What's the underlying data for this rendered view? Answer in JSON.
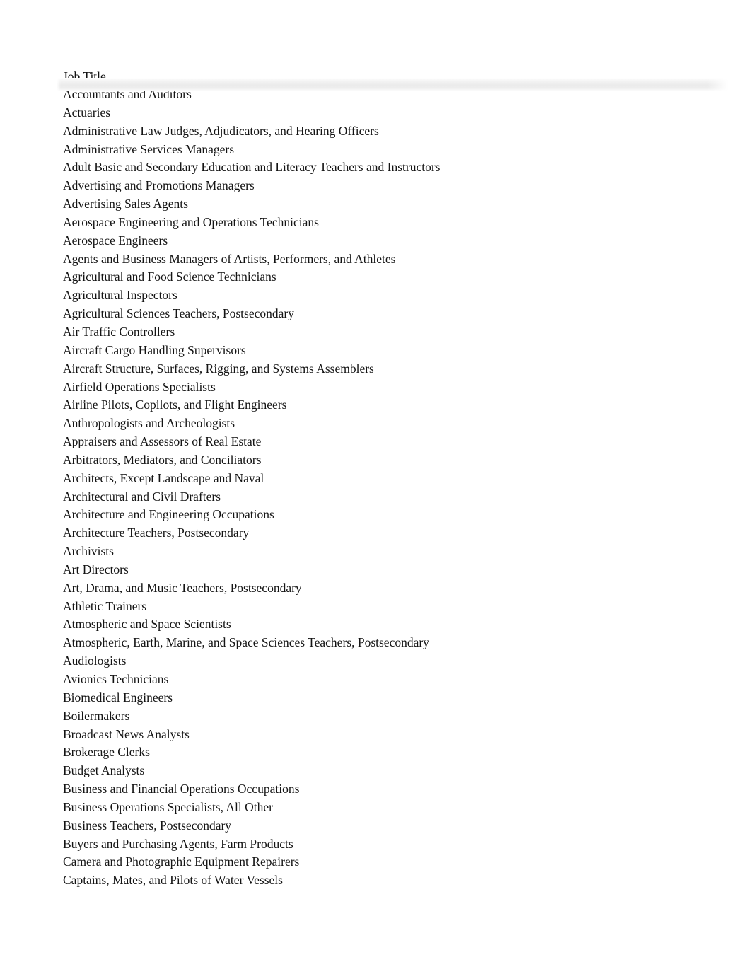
{
  "document": {
    "column_header": "Job Title",
    "text_color": "#141414",
    "background_color": "#ffffff",
    "freeze_shadow_color": "#ebebeb"
  },
  "table": {
    "columns": [
      "Job Title"
    ],
    "rows": [
      "Accountants and Auditors",
      "Actuaries",
      "Administrative Law Judges, Adjudicators, and Hearing Officers",
      "Administrative Services Managers",
      "Adult Basic and Secondary Education and Literacy Teachers and Instructors",
      "Advertising and Promotions Managers",
      "Advertising Sales Agents",
      "Aerospace Engineering and Operations Technicians",
      "Aerospace Engineers",
      "Agents and Business Managers of Artists, Performers, and Athletes",
      "Agricultural and Food Science Technicians",
      "Agricultural Inspectors",
      "Agricultural Sciences Teachers, Postsecondary",
      "Air Traffic Controllers",
      "Aircraft Cargo Handling Supervisors",
      "Aircraft Structure, Surfaces, Rigging, and Systems Assemblers",
      "Airfield Operations Specialists",
      "Airline Pilots, Copilots, and Flight Engineers",
      "Anthropologists and Archeologists",
      "Appraisers and Assessors of Real Estate",
      "Arbitrators, Mediators, and Conciliators",
      "Architects, Except Landscape and Naval",
      "Architectural and Civil Drafters",
      "Architecture and Engineering Occupations",
      "Architecture Teachers, Postsecondary",
      "Archivists",
      "Art Directors",
      "Art, Drama, and Music Teachers, Postsecondary",
      "Athletic Trainers",
      "Atmospheric and Space Scientists",
      "Atmospheric, Earth, Marine, and Space Sciences Teachers, Postsecondary",
      "Audiologists",
      "Avionics Technicians",
      "Biomedical Engineers",
      "Boilermakers",
      "Broadcast News Analysts",
      "Brokerage Clerks",
      "Budget Analysts",
      "Business and Financial Operations Occupations",
      "Business Operations Specialists, All Other",
      "Business Teachers, Postsecondary",
      "Buyers and Purchasing Agents, Farm Products",
      "Camera and Photographic Equipment Repairers",
      "Captains, Mates, and Pilots of Water Vessels"
    ]
  }
}
